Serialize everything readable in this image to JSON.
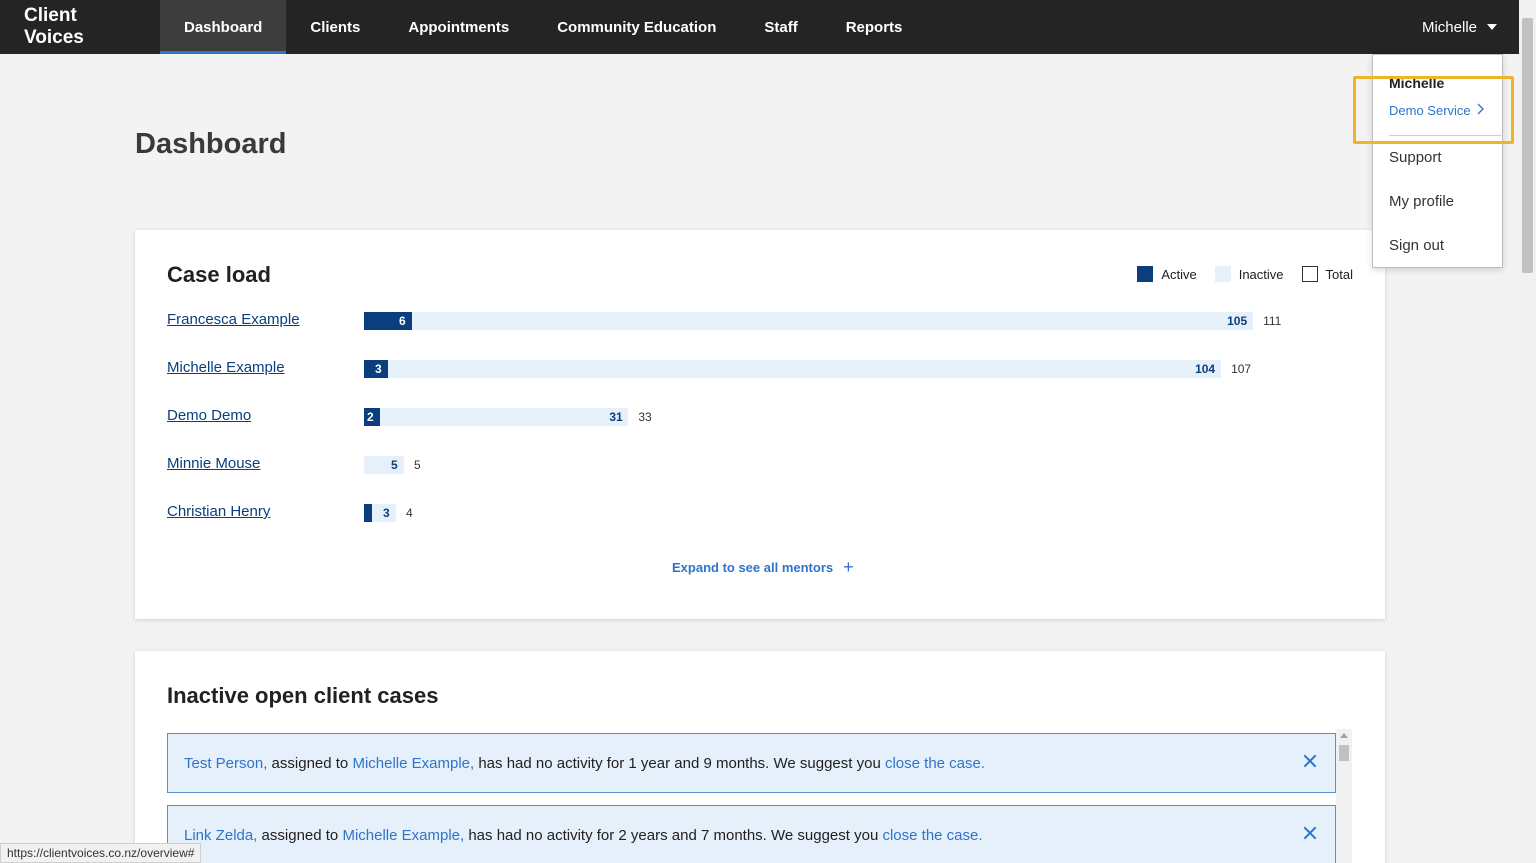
{
  "nav": {
    "brand": "Client Voices",
    "items": [
      {
        "label": "Dashboard",
        "active": true
      },
      {
        "label": "Clients",
        "active": false
      },
      {
        "label": "Appointments",
        "active": false
      },
      {
        "label": "Community Education",
        "active": false
      },
      {
        "label": "Staff",
        "active": false
      },
      {
        "label": "Reports",
        "active": false
      }
    ],
    "user": "Michelle"
  },
  "page": {
    "title": "Dashboard"
  },
  "caseload": {
    "title": "Case load",
    "legend": {
      "active": "Active",
      "inactive": "Inactive",
      "total": "Total"
    },
    "expand_label": "Expand to see all mentors",
    "colors": {
      "active": "#0a3e7e",
      "inactive": "#e6f0fa"
    }
  },
  "chart_data": {
    "type": "bar",
    "categories": [
      "Francesca Example",
      "Michelle Example",
      "Demo Demo",
      "Minnie Mouse",
      "Christian Henry"
    ],
    "series": [
      {
        "name": "Active",
        "values": [
          6,
          3,
          2,
          0,
          1
        ]
      },
      {
        "name": "Inactive",
        "values": [
          105,
          104,
          31,
          5,
          3
        ]
      },
      {
        "name": "Total",
        "values": [
          111,
          107,
          33,
          5,
          4
        ]
      }
    ],
    "active_labels": [
      "6",
      "3",
      "2",
      "",
      ""
    ],
    "inactive_labels": [
      "105",
      "104",
      "31",
      "5",
      "3"
    ],
    "total_labels": [
      "111",
      "107",
      "33",
      "5",
      "4"
    ]
  },
  "inactive_cases": {
    "title": "Inactive open client cases",
    "alerts": [
      {
        "client": "Test Person,",
        "assigned": "assigned to",
        "mentor": "Michelle Example,",
        "message": "has had no activity for 1 year and 9 months. We suggest you",
        "action": "close the case."
      },
      {
        "client": "Link Zelda,",
        "assigned": "assigned to",
        "mentor": "Michelle Example,",
        "message": "has had no activity for 2 years and 7 months. We suggest you",
        "action": "close the case."
      }
    ]
  },
  "dropdown": {
    "name": "Michelle",
    "service": "Demo Service",
    "items": [
      "Support",
      "My profile",
      "Sign out"
    ]
  },
  "status_url": "https://clientvoices.co.nz/overview#"
}
